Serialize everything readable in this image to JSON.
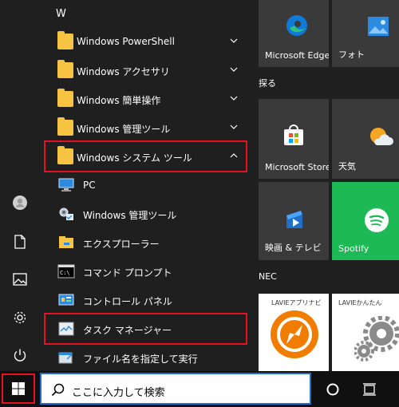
{
  "left_rail": {
    "items": [
      {
        "icon": "user-icon"
      },
      {
        "icon": "document-icon"
      },
      {
        "icon": "pictures-icon"
      },
      {
        "icon": "gear-icon"
      },
      {
        "icon": "power-icon"
      }
    ]
  },
  "app_list": {
    "section_letter": "W",
    "rows": [
      {
        "label": "Windows PowerShell",
        "type": "folder",
        "expanded": false
      },
      {
        "label": "Windows アクセサリ",
        "type": "folder",
        "expanded": false
      },
      {
        "label": "Windows 簡単操作",
        "type": "folder",
        "expanded": false
      },
      {
        "label": "Windows 管理ツール",
        "type": "folder",
        "expanded": false
      },
      {
        "label": "Windows システム ツール",
        "type": "folder",
        "expanded": true
      },
      {
        "label": "PC",
        "type": "app",
        "icon": "pc-icon"
      },
      {
        "label": "Windows 管理ツール",
        "type": "app",
        "icon": "admin-tools-icon"
      },
      {
        "label": "エクスプローラー",
        "type": "app",
        "icon": "explorer-folder-icon"
      },
      {
        "label": "コマンド プロンプト",
        "type": "app",
        "icon": "command-prompt-icon"
      },
      {
        "label": "コントロール パネル",
        "type": "app",
        "icon": "control-panel-icon"
      },
      {
        "label": "タスク マネージャー",
        "type": "app",
        "icon": "task-manager-icon"
      },
      {
        "label": "ファイル名を指定して実行",
        "type": "app",
        "icon": "run-icon"
      }
    ]
  },
  "tiles": {
    "groups": [
      "探る",
      "NEC"
    ],
    "items": [
      {
        "label": "Microsoft Edge",
        "icon": "edge-icon"
      },
      {
        "label": "フォト",
        "icon": "photos-icon"
      },
      {
        "label": "Microsoft Store",
        "icon": "store-icon"
      },
      {
        "label": "天気",
        "icon": "weather-icon"
      },
      {
        "label": "映画 & テレビ",
        "icon": "movies-tv-icon"
      },
      {
        "label": "Spotify",
        "icon": "spotify-icon"
      },
      {
        "label": "LAVIEアプリナビ",
        "icon": "lavie-app-navi-icon"
      },
      {
        "label": "LAVIEかんたん",
        "icon": "lavie-gears-icon"
      }
    ]
  },
  "taskbar": {
    "start_icon": "windows-logo-icon",
    "search_placeholder": "ここに入力して検索",
    "cortana_icon": "cortana-circle-icon",
    "task_view_icon": "task-view-icon"
  },
  "colors": {
    "highlight": "#e81123",
    "folder": "#f6c343",
    "edge_blue": "#0f7ad8",
    "spotify_green": "#1db954",
    "movies_blue": "#1f71c8",
    "taskbar": "#101010"
  }
}
